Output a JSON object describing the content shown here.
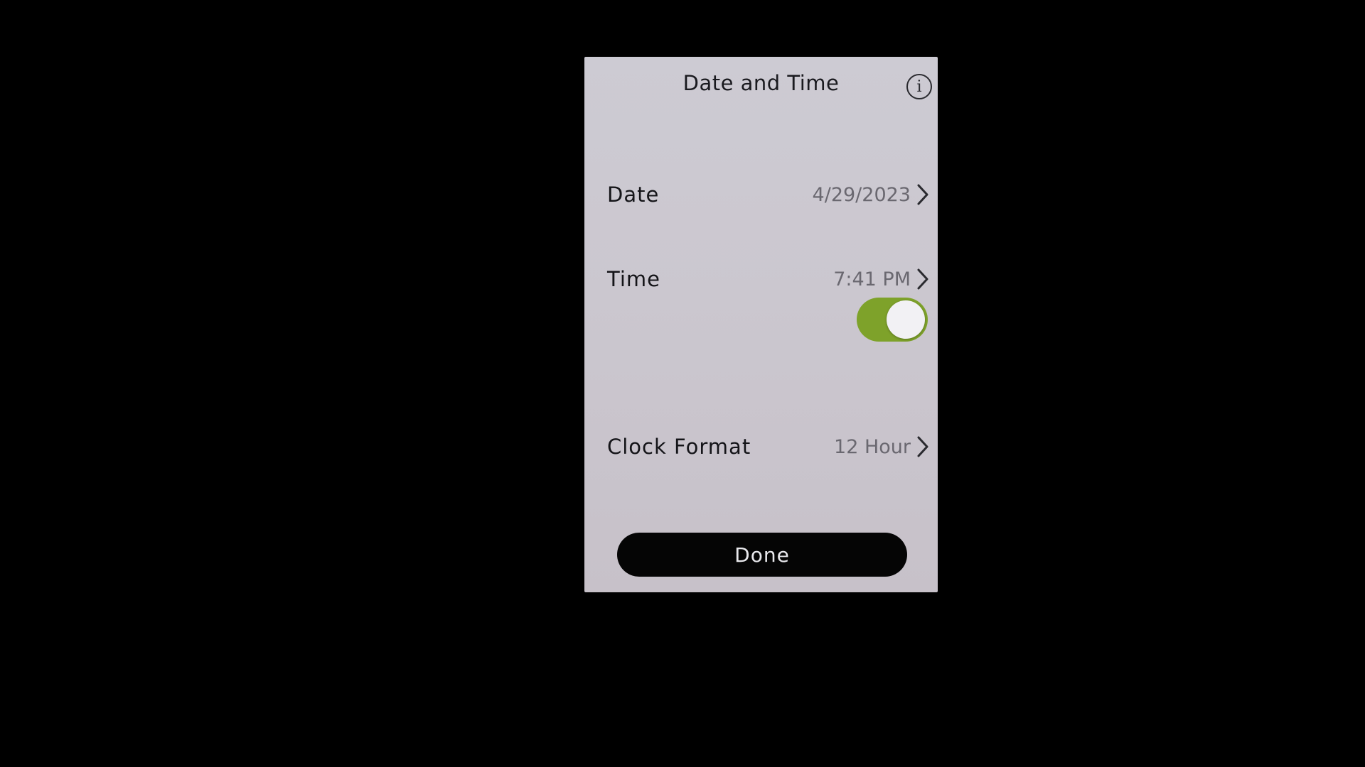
{
  "header": {
    "title": "Date and Time",
    "info_icon": "info-icon"
  },
  "rows": [
    {
      "label": "Date",
      "value": "4/29/2023",
      "icon": "chevron-right-icon"
    },
    {
      "label": "Time",
      "value": "7:41 PM",
      "icon": "chevron-right-icon"
    },
    {
      "label": "Clock Format",
      "value": "12 Hour",
      "icon": "chevron-right-icon"
    }
  ],
  "toggle": {
    "state": "on",
    "color": "#7ea22a"
  },
  "footer": {
    "done_label": "Done"
  }
}
